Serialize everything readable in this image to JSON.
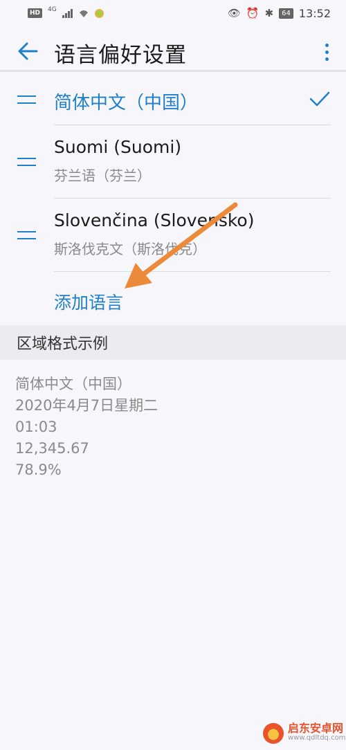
{
  "status_bar": {
    "network_badge": "HD",
    "network_type": "4G",
    "battery": "64",
    "time": "13:52"
  },
  "header": {
    "title": "语言偏好设置"
  },
  "languages": [
    {
      "name": "简体中文（中国）",
      "sub": "",
      "selected": true
    },
    {
      "name": "Suomi (Suomi)",
      "sub": "芬兰语（芬兰）",
      "selected": false
    },
    {
      "name": "Slovenčina (Slovensko)",
      "sub": "斯洛伐克文（斯洛伐克）",
      "selected": false
    }
  ],
  "add_language_label": "添加语言",
  "regional": {
    "section_title": "区域格式示例",
    "lines": [
      "简体中文（中国）",
      "2020年4月7日星期二",
      "01:03",
      "12,345.67",
      "78.9%"
    ]
  },
  "watermark": {
    "title": "启东安卓网",
    "url": "www.qdltdq.com"
  },
  "colors": {
    "accent": "#1f7fc8",
    "annotation_arrow": "#ec8a3a"
  }
}
